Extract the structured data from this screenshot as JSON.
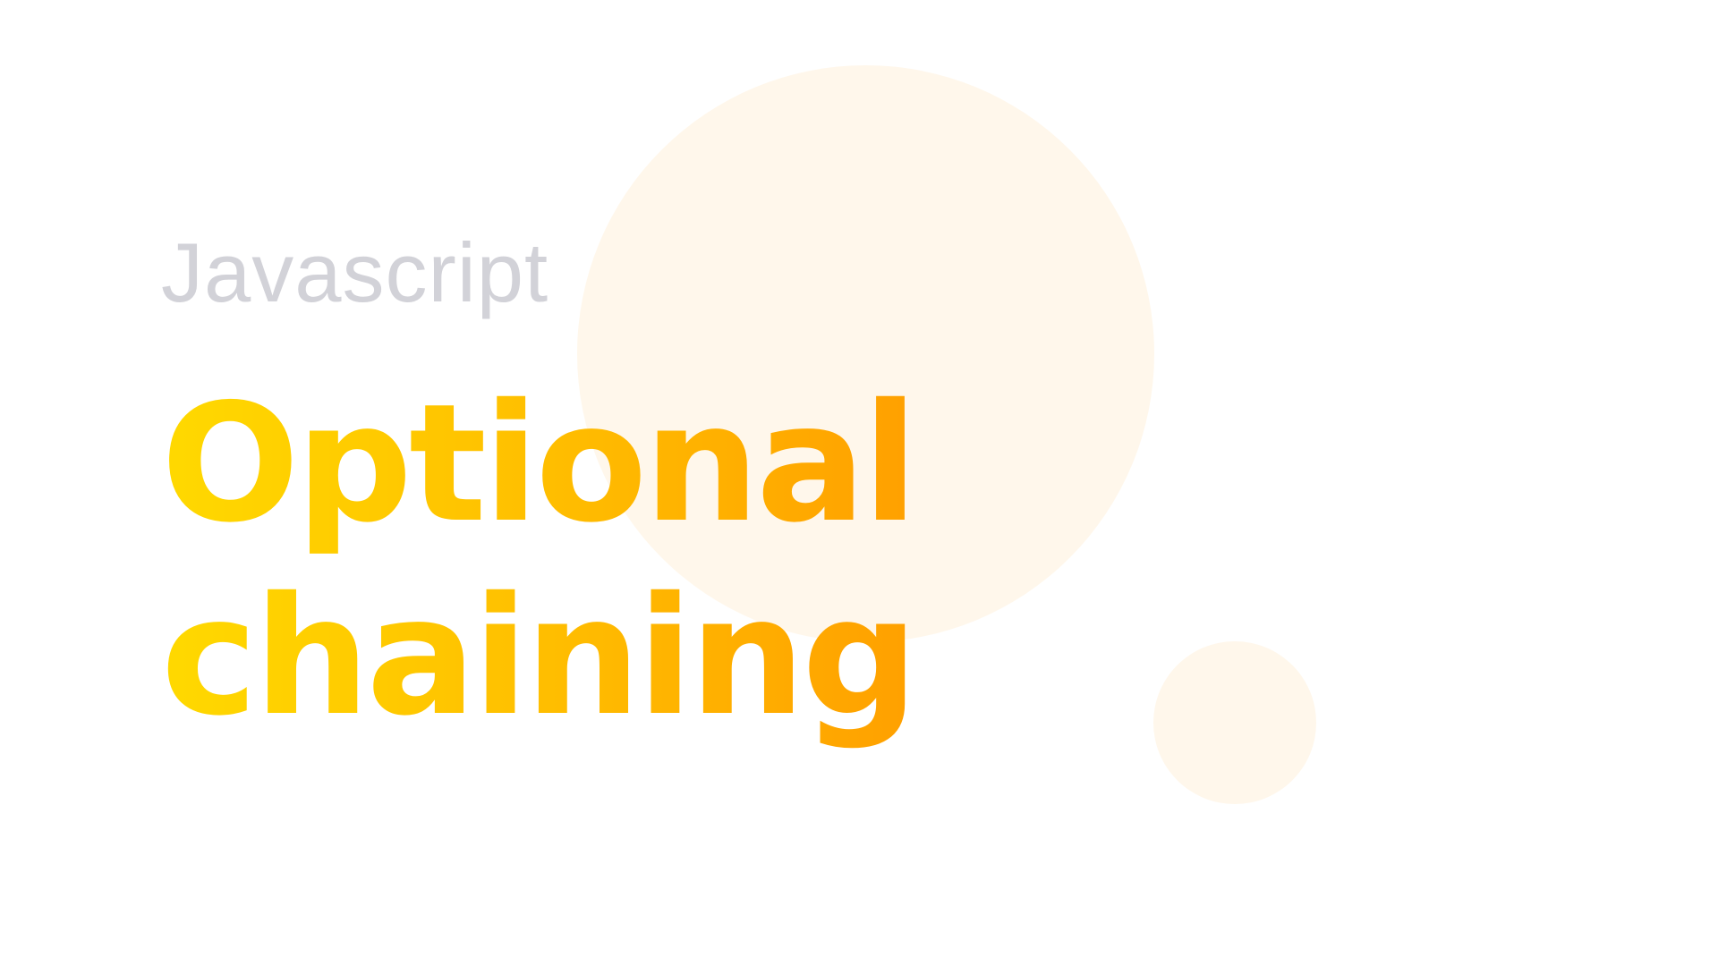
{
  "slide": {
    "eyebrow": "Javascript",
    "title_line_1": "Optional",
    "title_line_2": "chaining"
  },
  "colors": {
    "background": "#ffffff",
    "eyebrow": "#d2d2d8",
    "title_gradient_start": "#ffd900",
    "title_gradient_end": "#ffa000",
    "decorative_circle": "#fff7eb"
  }
}
